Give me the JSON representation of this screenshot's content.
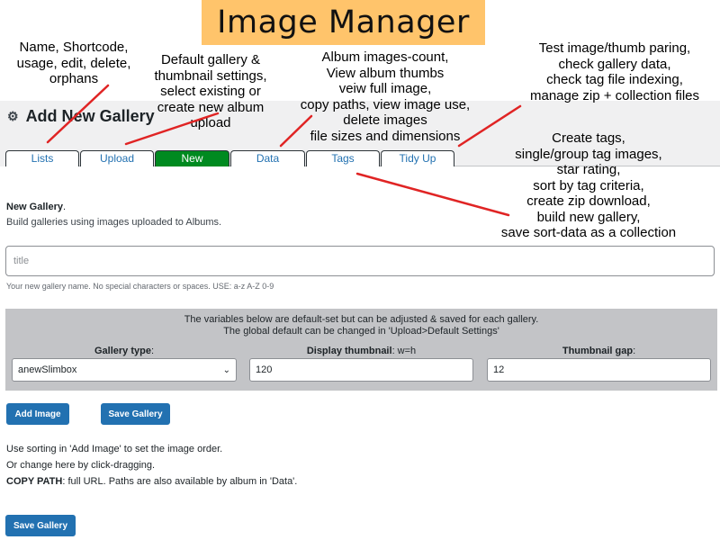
{
  "banner": {
    "title": "Image Manager"
  },
  "annotations": {
    "lists": "Name, Shortcode,\nusage, edit, delete,\norphans",
    "upload": "Default gallery &\nthumbnail settings,\nselect existing or\ncreate new album\nupload",
    "data": "Album images-count,\nView album thumbs\nveiw full image,\ncopy paths, view image use,\ndelete images\nfile sizes and dimensions",
    "tidyup": "Test image/thumb paring,\ncheck gallery data,\ncheck tag file indexing,\nmanage zip + collection files",
    "tags": "Create tags,\nsingle/group tag images,\nstar rating,\nsort by tag criteria,\ncreate zip download,\nbuild new gallery,\nsave sort-data as a collection"
  },
  "header": {
    "title": "Add New Gallery",
    "icon": "gear-icon"
  },
  "tabs": [
    {
      "label": "Lists",
      "active": false
    },
    {
      "label": "Upload",
      "active": false
    },
    {
      "label": "New",
      "active": true
    },
    {
      "label": "Data",
      "active": false
    },
    {
      "label": "Tags",
      "active": false
    },
    {
      "label": "Tidy Up",
      "active": false
    }
  ],
  "new_gallery": {
    "heading": "New Gallery",
    "heading_suffix": ".",
    "subtitle": "Build galleries using images uploaded to Albums.",
    "title_placeholder": "title",
    "title_value": "",
    "hint": "Your new gallery name. No special characters or spaces. USE: a-z A-Z 0-9"
  },
  "settings": {
    "line1": "The variables below are default-set but can be adjusted & saved for each gallery.",
    "line2": "The global default can be changed in 'Upload>Default Settings'",
    "gallery_type_label": "Gallery type",
    "gallery_type_suffix": ":",
    "gallery_type_value": "anewSlimbox",
    "display_thumb_label": "Display thumbnail",
    "display_thumb_suffix": ": w=h",
    "display_thumb_value": "120",
    "thumb_gap_label": "Thumbnail gap",
    "thumb_gap_suffix": ":",
    "thumb_gap_value": "12"
  },
  "buttons": {
    "add_image": "Add Image",
    "save_gallery": "Save Gallery",
    "save_gallery_bottom": "Save Gallery"
  },
  "instructions": {
    "line1": "Use sorting in 'Add Image' to set the image order.",
    "line2": "Or change here by click-dragging.",
    "copy_path_label": "COPY PATH",
    "copy_path_text": ": full URL. Paths are also available by album in 'Data'."
  },
  "colors": {
    "banner": "#ffc46b",
    "active_tab": "#008a20",
    "button": "#2271b1",
    "arrow": "#e02424"
  }
}
